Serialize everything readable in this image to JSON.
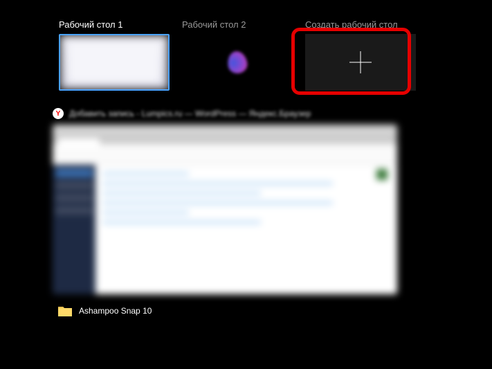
{
  "desktops": {
    "items": [
      {
        "label": "Рабочий стол 1",
        "active": true
      },
      {
        "label": "Рабочий стол 2",
        "active": false
      }
    ],
    "new_label": "Создать рабочий стол"
  },
  "window": {
    "title": "Добавить запись - Lumpics.ru — WordPress — Яндекс.Браузер",
    "icon": "yandex-icon"
  },
  "folder": {
    "label": "Ashampoo Snap 10",
    "icon": "folder-icon"
  },
  "colors": {
    "highlight": "#e60000",
    "active_border": "#4aa3ff"
  }
}
